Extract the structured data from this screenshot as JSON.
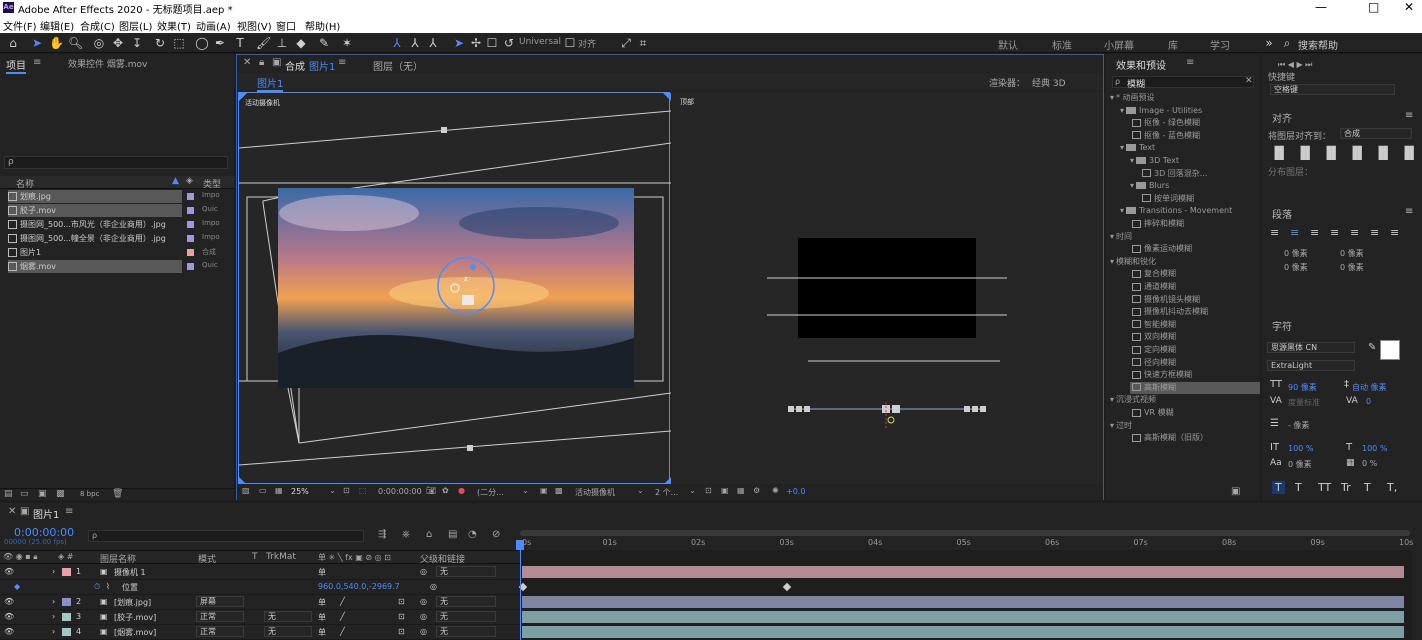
{
  "window": {
    "title": "Adobe After Effects 2020 - 无标题项目.aep *",
    "logo": "Ae",
    "minimize": "—",
    "maximize": "□",
    "close": "✕"
  },
  "menu": [
    "文件(F)",
    "编辑(E)",
    "合成(C)",
    "图层(L)",
    "效果(T)",
    "动画(A)",
    "视图(V)",
    "窗口",
    "帮助(H)"
  ],
  "toolbar": {
    "universal": "Universal",
    "align": "对齐",
    "workspaces": [
      "默认",
      "标准",
      "小屏幕",
      "库",
      "学习"
    ],
    "search_help": "搜索帮助"
  },
  "project": {
    "tab": "项目",
    "tab2": "效果控件 烟雾.mov",
    "search_placeholder": "ρ",
    "col_name": "名称",
    "col_type": "类型",
    "bpc": "8 bpc",
    "items": [
      {
        "name": "划痕.jpg",
        "type": "Impo"
      },
      {
        "name": "胶子.mov",
        "type": "Quic"
      },
      {
        "name": "摄图网_500...市风光（非企业商用）.jpg",
        "type": "Impo"
      },
      {
        "name": "摄图网_500...幢全景（非企业商用）.jpg",
        "type": "Impo"
      },
      {
        "name": "图片1",
        "type": "合成"
      },
      {
        "name": "烟雾.mov",
        "type": "Quic"
      }
    ]
  },
  "composition": {
    "tab": "合成",
    "tab_name": "图片1",
    "layer_tab": "图层（无）",
    "sub_tab": "图片1",
    "renderer_label": "渲染器：",
    "renderer": "经典 3D",
    "left_view": "活动摄像机",
    "right_view": "顶部",
    "zoom": "25%",
    "timecode": "0:00:00:00",
    "resolution": "(二分...",
    "camera": "活动摄像机",
    "views": "2 个...",
    "exposure": "+0.0"
  },
  "effects": {
    "tab": "效果和预设",
    "search": "模糊",
    "tree": [
      {
        "label": "* 动画预设",
        "indent": 0,
        "kind": "cat"
      },
      {
        "label": "Image - Utilities",
        "indent": 1,
        "kind": "folder"
      },
      {
        "label": "抠像 - 绿色模糊",
        "indent": 2,
        "kind": "fx"
      },
      {
        "label": "抠像 - 蓝色模糊",
        "indent": 2,
        "kind": "fx"
      },
      {
        "label": "Text",
        "indent": 1,
        "kind": "folder"
      },
      {
        "label": "3D Text",
        "indent": 2,
        "kind": "folder"
      },
      {
        "label": "3D 回落混杂...",
        "indent": 3,
        "kind": "fx"
      },
      {
        "label": "Blurs",
        "indent": 2,
        "kind": "folder"
      },
      {
        "label": "按单词模糊",
        "indent": 3,
        "kind": "fx"
      },
      {
        "label": "Transitions - Movement",
        "indent": 1,
        "kind": "folder"
      },
      {
        "label": "摔碎和模糊",
        "indent": 2,
        "kind": "fx"
      },
      {
        "label": "时间",
        "indent": 0,
        "kind": "cat"
      },
      {
        "label": "像素运动模糊",
        "indent": 2,
        "kind": "fx"
      },
      {
        "label": "模糊和锐化",
        "indent": 0,
        "kind": "cat"
      },
      {
        "label": "复合模糊",
        "indent": 2,
        "kind": "fx"
      },
      {
        "label": "通道模糊",
        "indent": 2,
        "kind": "fx"
      },
      {
        "label": "摄像机镜头模糊",
        "indent": 2,
        "kind": "fx"
      },
      {
        "label": "摄像机抖动去模糊",
        "indent": 2,
        "kind": "fx"
      },
      {
        "label": "智能模糊",
        "indent": 2,
        "kind": "fx"
      },
      {
        "label": "双向模糊",
        "indent": 2,
        "kind": "fx"
      },
      {
        "label": "定向模糊",
        "indent": 2,
        "kind": "fx"
      },
      {
        "label": "径向模糊",
        "indent": 2,
        "kind": "fx"
      },
      {
        "label": "快速方框模糊",
        "indent": 2,
        "kind": "fx"
      },
      {
        "label": "高斯模糊",
        "indent": 2,
        "kind": "fx",
        "selected": true
      },
      {
        "label": "沉浸式视频",
        "indent": 0,
        "kind": "cat"
      },
      {
        "label": "VR 模糊",
        "indent": 2,
        "kind": "fx"
      },
      {
        "label": "过时",
        "indent": 0,
        "kind": "cat"
      },
      {
        "label": "高斯模糊（旧版）",
        "indent": 2,
        "kind": "fx"
      }
    ]
  },
  "right": {
    "shortcut_label": "快捷键",
    "shortcut": "空格键",
    "align_title": "对齐",
    "align_to_label": "将图层对齐到：",
    "align_to": "合成",
    "distribute": "分布图层：",
    "para_title": "段落",
    "px": "0 像素",
    "char_title": "字符",
    "font": "思源黑体 CN",
    "style": "ExtraLight",
    "size": "90 像素",
    "leading": "自动 像素",
    "tracking": "0",
    "tracking_unit": "度量标准",
    "stroke": "- 像素",
    "scale_v": "100 %",
    "scale_h": "100 %",
    "baseline": "0 像素",
    "tsume": "0 %",
    "text_styles": [
      "T",
      "T",
      "TT",
      "Tr",
      "T",
      "T,"
    ]
  },
  "timeline": {
    "tab": "图片1",
    "timecode": "0:00:00:00",
    "fps": "00000 (25.00 fps)",
    "search_placeholder": "ρ",
    "headers": {
      "name": "图层名称",
      "mode": "模式",
      "t": "T",
      "trkmat": "TrkMat",
      "parent": "父级和链接"
    },
    "ruler": [
      "0s",
      "01s",
      "02s",
      "03s",
      "04s",
      "05s",
      "06s",
      "07s",
      "08s",
      "09s",
      "10s"
    ],
    "layers": [
      {
        "num": "1",
        "name": "摄像机 1",
        "mode": "",
        "trk": "",
        "parent": "无",
        "color": "#e8a0a8",
        "bar": "#b48c93"
      },
      {
        "num": "2",
        "name": "[划痕.jpg]",
        "mode": "屏幕",
        "trk": "",
        "parent": "无",
        "color": "#8e8ec8",
        "bar": "#7f86a3"
      },
      {
        "num": "3",
        "name": "[胶子.mov]",
        "mode": "正常",
        "trk": "无",
        "parent": "无",
        "color": "#a0c8c8",
        "bar": "#7fa0a3"
      },
      {
        "num": "4",
        "name": "[烟雾.mov]",
        "mode": "正常",
        "trk": "无",
        "parent": "无",
        "color": "#a0c8c8",
        "bar": "#7fa0a3"
      }
    ],
    "position_label": "位置",
    "position_value": "960.0,540.0,-2969.7"
  }
}
